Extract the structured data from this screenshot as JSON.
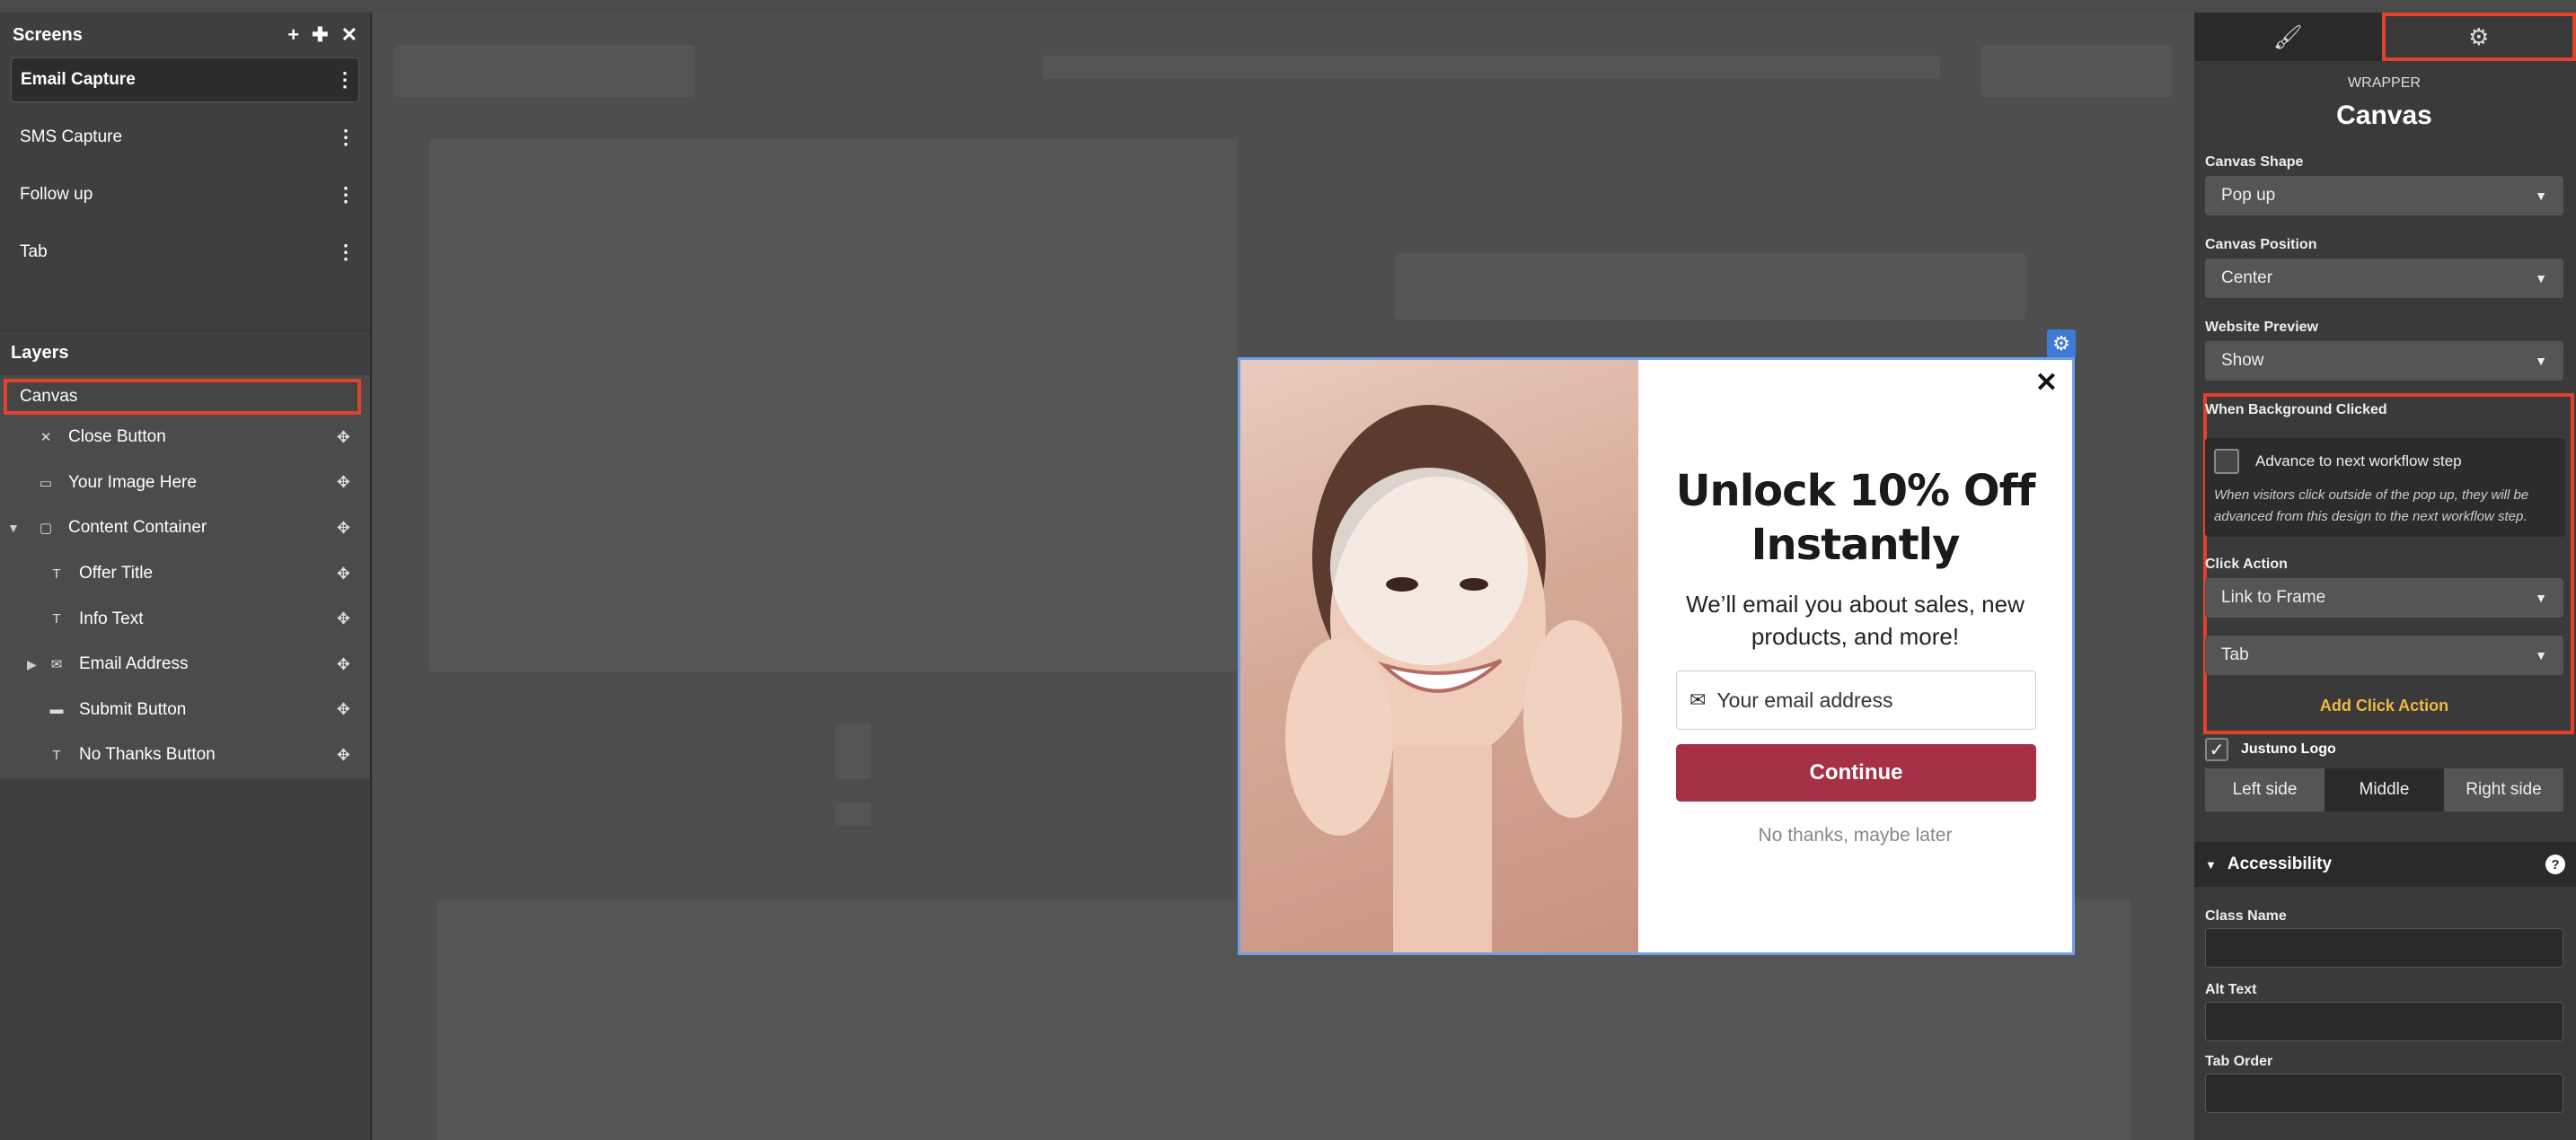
{
  "screens": {
    "header": "Screens",
    "items": [
      {
        "label": "Email Capture",
        "active": true
      },
      {
        "label": "SMS Capture",
        "active": false
      },
      {
        "label": "Follow up",
        "active": false
      },
      {
        "label": "Tab",
        "active": false
      }
    ]
  },
  "layers": {
    "header": "Layers",
    "selected": "Canvas",
    "items": [
      {
        "label": "Close Button",
        "icon": "close-icon"
      },
      {
        "label": "Your Image Here",
        "icon": "image-icon"
      },
      {
        "label": "Content Container",
        "icon": "container-icon"
      },
      {
        "label": "Offer Title",
        "icon": "text-icon"
      },
      {
        "label": "Info Text",
        "icon": "text-icon"
      },
      {
        "label": "Email Address",
        "icon": "email-icon"
      },
      {
        "label": "Submit Button",
        "icon": "button-icon"
      },
      {
        "label": "No Thanks Button",
        "icon": "text-icon"
      }
    ]
  },
  "popup": {
    "title": "Unlock 10% Off Instantly",
    "info": "We’ll email you about sales, new products, and more!",
    "email_placeholder": "Your email address",
    "button": "Continue",
    "no_thanks": "No thanks, maybe later",
    "button_color": "#a63045"
  },
  "properties": {
    "wrapper_label": "WRAPPER",
    "title": "Canvas",
    "canvas_shape": {
      "label": "Canvas Shape",
      "value": "Pop up"
    },
    "canvas_position": {
      "label": "Canvas Position",
      "value": "Center"
    },
    "website_preview": {
      "label": "Website Preview",
      "value": "Show"
    },
    "background_clicked": {
      "label": "When Background Clicked",
      "advance_label": "Advance to next workflow step",
      "advance_help": "When visitors click outside of the pop up, they will be advanced from this design to the next workflow step."
    },
    "click_action": {
      "label": "Click Action",
      "value": "Link to Frame",
      "target": "Tab",
      "add_label": "Add Click Action"
    },
    "justuno_logo": {
      "label": "Justuno Logo",
      "options": [
        "Left side",
        "Middle",
        "Right side"
      ],
      "selected": "Middle"
    },
    "accessibility": {
      "header": "Accessibility",
      "class_name": "Class Name",
      "alt_text": "Alt Text",
      "tab_order": "Tab Order"
    },
    "accent_color": "#e2412d",
    "link_color": "#f0b840"
  }
}
